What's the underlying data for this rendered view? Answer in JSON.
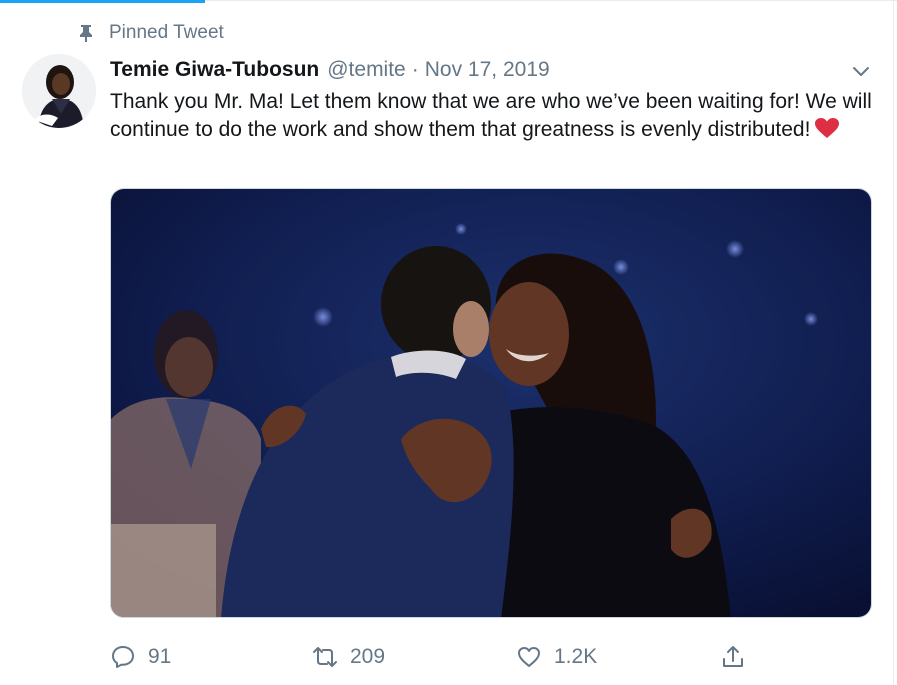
{
  "pinned": {
    "label": "Pinned Tweet",
    "icon": "pin-icon"
  },
  "tweet": {
    "author": {
      "display_name": "Temie Giwa-Tubosun",
      "handle": "@temite",
      "avatar_icon": "profile-photo"
    },
    "separator": "·",
    "date": "Nov 17, 2019",
    "text": "Thank you Mr. Ma! Let them know that we are who we’ve been waiting for! We will continue to do the work and show them that greatness is evenly distributed!",
    "emoji": "red-heart",
    "media": {
      "type": "photo",
      "description_icon": "tweet-photo"
    },
    "actions": {
      "reply_count": "91",
      "retweet_count": "209",
      "like_count": "1.2K",
      "share_icon": "share-icon"
    }
  },
  "colors": {
    "accent": "#1da1f2",
    "secondary_text": "#657786",
    "primary_text": "#14171a",
    "heart": "#e0245e",
    "media_background": "#0f1a4a"
  }
}
